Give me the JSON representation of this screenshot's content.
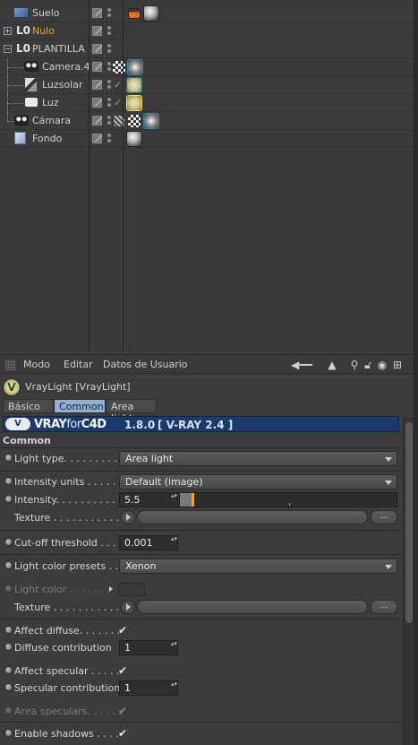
{
  "object_manager": {
    "objects": [
      {
        "name": "Suelo",
        "highlight": false,
        "tags": [
          "clapper-icon",
          "sphere-material-icon"
        ],
        "check": ""
      },
      {
        "name": "Nulo",
        "highlight": true,
        "tags": [],
        "check": ""
      },
      {
        "name": "PLANTILLA",
        "highlight": false,
        "tags": [],
        "check": ""
      },
      {
        "name": "Camera.4",
        "highlight": false,
        "tags": [
          "checker-tag-icon",
          "camera-tag-icon"
        ],
        "check": ""
      },
      {
        "name": "Luzsolar",
        "highlight": false,
        "tags": [
          "vray-light-tag-icon"
        ],
        "check": "✓"
      },
      {
        "name": "Luz",
        "highlight": false,
        "tags": [
          "vray-light-tag-icon"
        ],
        "check": "✓"
      },
      {
        "name": "Cámara",
        "highlight": false,
        "tags": [
          "pin-tag-icon",
          "checker-tag-icon",
          "camera-tag-icon"
        ],
        "check": ""
      },
      {
        "name": "Fondo",
        "highlight": false,
        "tags": [
          "sphere-material-icon"
        ],
        "check": ""
      }
    ]
  },
  "attribute_manager": {
    "menu": {
      "modo": "Modo",
      "editar": "Editar",
      "datos": "Datos de Usuario"
    },
    "object_title": "VrayLight [VrayLight]",
    "tabs": [
      {
        "label": "Básico",
        "active": false
      },
      {
        "label": "Common",
        "active": true
      },
      {
        "label": "Area light",
        "active": false
      }
    ],
    "vray_bar": {
      "brand_bold": "VRAY",
      "brand_thin": "for",
      "brand_tail": "C4D",
      "version": "1.8.0",
      "core": "[ V-RAY 2.4 ]",
      "logo": "V"
    },
    "section": "Common",
    "params": {
      "light_type": {
        "label": "Light type. . . . . . . . . .",
        "value": "Area light"
      },
      "intensity_units": {
        "label": "Intensity units . . . . . .",
        "value": "Default (image)"
      },
      "intensity": {
        "label": "Intensity. . . . . . . . . . .",
        "value": "5.5",
        "slider_fraction": 0.055
      },
      "texture1": {
        "label": "Texture . . . . . . . . . . . .",
        "more": "..."
      },
      "cutoff": {
        "label": "Cut-off threshold . . .",
        "value": "0.001"
      },
      "light_color_presets": {
        "label": "Light color presets . .",
        "value": "Xenon"
      },
      "light_color": {
        "label": "Light color . . . . . . .",
        "value": ""
      },
      "texture2": {
        "label": "Texture . . . . . . . . . . . .",
        "more": "..."
      },
      "affect_diffuse": {
        "label": "Affect diffuse. . . . . . .",
        "checked": "✔"
      },
      "diffuse_contribution": {
        "label": "Diffuse contribution",
        "value": "1"
      },
      "affect_specular": {
        "label": "Affect specular . . . . .",
        "checked": "✔"
      },
      "specular_contribution": {
        "label": "Specular contribution",
        "value": "1"
      },
      "area_speculars": {
        "label": "Area speculars. . . . . .",
        "checked": "✔"
      },
      "enable_shadows": {
        "label": "Enable shadows . . . .",
        "checked": "✔"
      }
    }
  },
  "colors": {
    "accent_orange": "#f0a630",
    "tab_active": "#8fb0cf",
    "vray_blue": "#1b3a6b",
    "check_green": "#5fcf3d"
  }
}
